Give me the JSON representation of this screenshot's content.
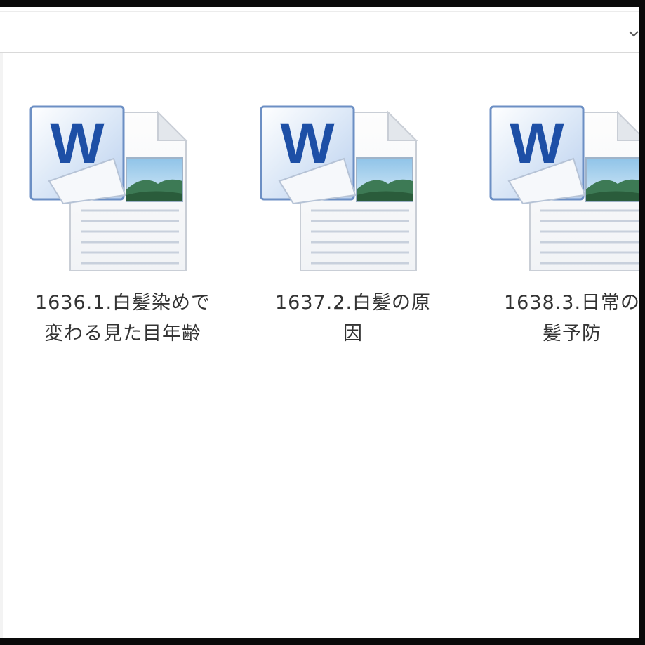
{
  "window": {
    "background": "#ffffff",
    "frame_color": "#0a0a0a"
  },
  "toolbar": {
    "dropdown_icon": "chevron-down-icon"
  },
  "files": [
    {
      "name": "1636.1.白髪染めで\n変わる見た目年齢",
      "icon": "word-document-icon"
    },
    {
      "name": "1637.2.白髪の原\n因",
      "icon": "word-document-icon"
    },
    {
      "name": "1638.3.日常の\n髪予防",
      "icon": "word-document-icon"
    }
  ],
  "colors": {
    "word_blue": "#1d4fa6",
    "word_blue_light": "#6a9cdb",
    "page_lines": "#c8d0dc"
  }
}
